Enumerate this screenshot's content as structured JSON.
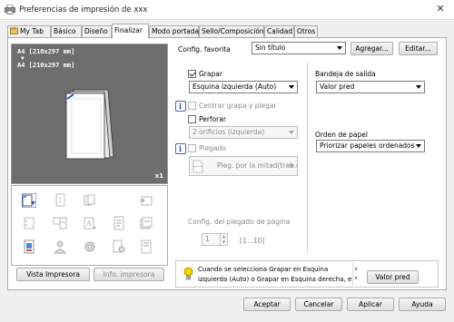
{
  "window": {
    "title": "Preferencias de impresión de xxx",
    "close_glyph": "✕"
  },
  "tabs": [
    {
      "label": "My Tab"
    },
    {
      "label": "Básico"
    },
    {
      "label": "Diseño"
    },
    {
      "label": "Finalizar",
      "active": true
    },
    {
      "label": "Modo portada"
    },
    {
      "label": "Sello/Composición"
    },
    {
      "label": "Calidad"
    },
    {
      "label": "Otros"
    }
  ],
  "preview": {
    "line1": "A4 [210x297 mm]",
    "arrow": "▼",
    "line2": "A4 [210x297 mm]",
    "copies": "x1"
  },
  "left_buttons": {
    "view_printer": "Vista Impresora",
    "printer_info": "Info. impresora"
  },
  "favorites": {
    "label": "Config. favorita",
    "value": "Sin título",
    "add": "Agregar...",
    "edit": "Editar..."
  },
  "staple": {
    "label": "Grapar",
    "checked": true,
    "value": "Esquina izquierda (Auto)"
  },
  "center_staple": {
    "label": "Centrar grapa y plegar"
  },
  "punch": {
    "label": "Perforar",
    "value": "2 orificios (izquierda)"
  },
  "fold": {
    "label": "Plegado",
    "value": "Pleg. por la mitad(trab.c"
  },
  "fold_pages": {
    "label": "Config. del plegado de página",
    "value": "1",
    "range": "[1...10]"
  },
  "output_tray": {
    "label": "Bandeja de salida",
    "value": "Valor pred"
  },
  "paper_order": {
    "label": "Orden de papel",
    "value": "Priorizar papeles ordenados"
  },
  "tip": {
    "line1": "Cuando se selecciona Grapar en Esquina",
    "line2": "izquierda (Auto) o Grapar en Esquina derecha, el",
    "default_button": "Valor pred"
  },
  "footer": {
    "ok": "Aceptar",
    "cancel": "Cancelar",
    "apply": "Aplicar",
    "help": "Ayuda"
  },
  "colors": {
    "preview_bg": "#6e6e6e",
    "info_blue": "#1b4f9c",
    "bulb_yellow": "#f5d400"
  }
}
